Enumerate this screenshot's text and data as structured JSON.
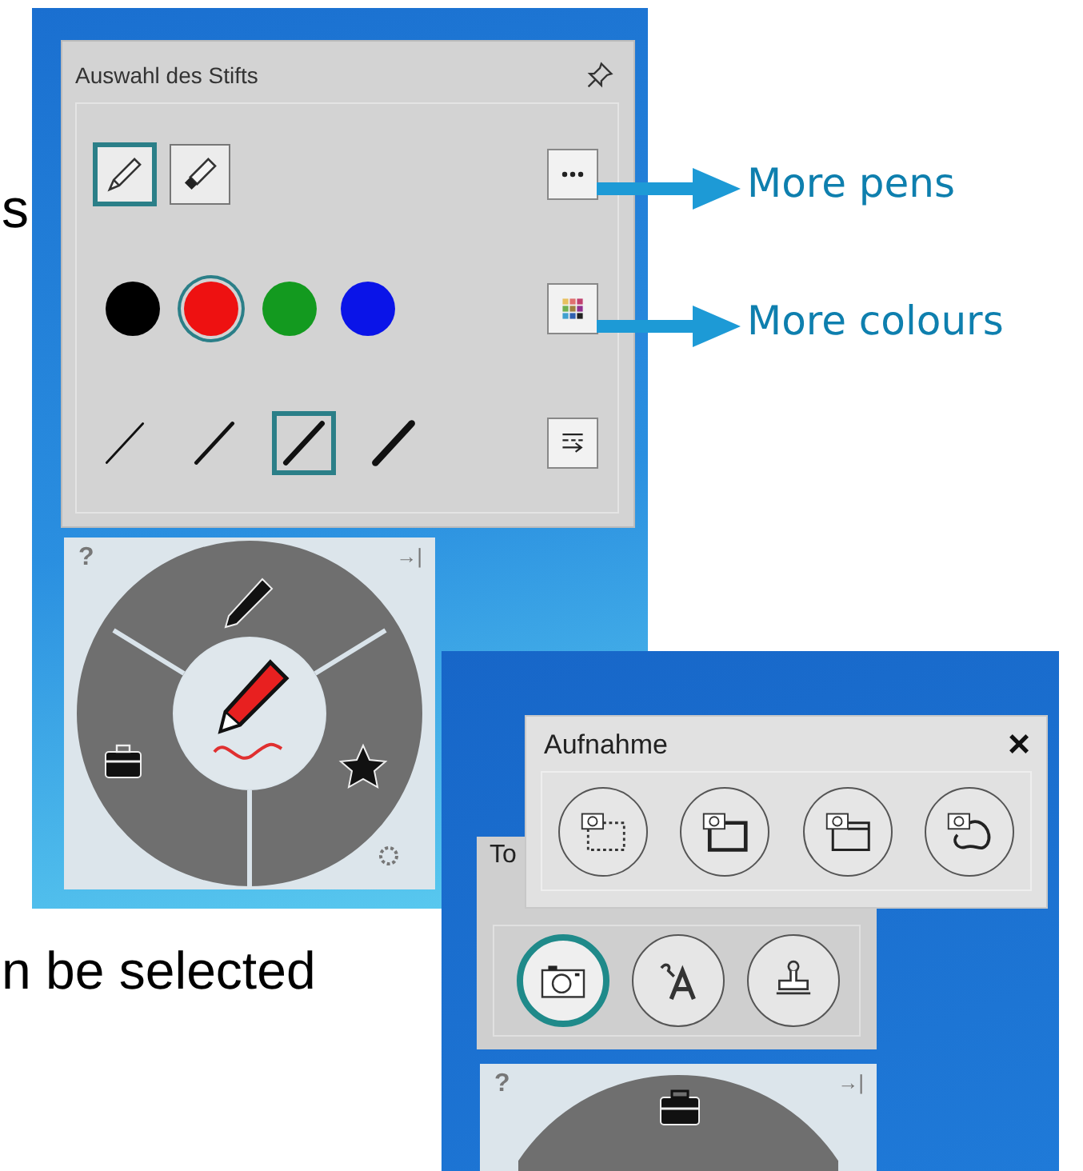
{
  "body_text": [
    "s",
    "n be selected"
  ],
  "pen_panel": {
    "title": "Auswahl des Stifts",
    "pen_types": [
      {
        "kind": "pencil",
        "selected": true
      },
      {
        "kind": "marker",
        "selected": false
      }
    ],
    "colors": [
      {
        "color": "#000000",
        "selected": false
      },
      {
        "color": "#ee1111",
        "selected": true
      },
      {
        "color": "#139a1f",
        "selected": false
      },
      {
        "color": "#0a14e8",
        "selected": false
      }
    ],
    "widths": [
      {
        "kind": "thin",
        "selected": false
      },
      {
        "kind": "medium",
        "selected": false
      },
      {
        "kind": "thick",
        "selected": true
      },
      {
        "kind": "extra-thick",
        "selected": false
      }
    ]
  },
  "callouts": [
    "More pens",
    "More colours"
  ],
  "radial_menu": {
    "help": "?",
    "collapse": "→|"
  },
  "capture_popup": {
    "title": "Aufnahme",
    "close": "×",
    "tools": [
      {
        "kind": "area"
      },
      {
        "kind": "window"
      },
      {
        "kind": "screen"
      },
      {
        "kind": "freehand"
      }
    ]
  },
  "toolbox_panel": {
    "title": "To",
    "tools": [
      {
        "kind": "camera",
        "selected": true
      },
      {
        "kind": "text",
        "selected": false
      },
      {
        "kind": "stamp",
        "selected": false
      }
    ]
  },
  "radial_menu_2": {
    "help": "?",
    "collapse": "→|"
  }
}
